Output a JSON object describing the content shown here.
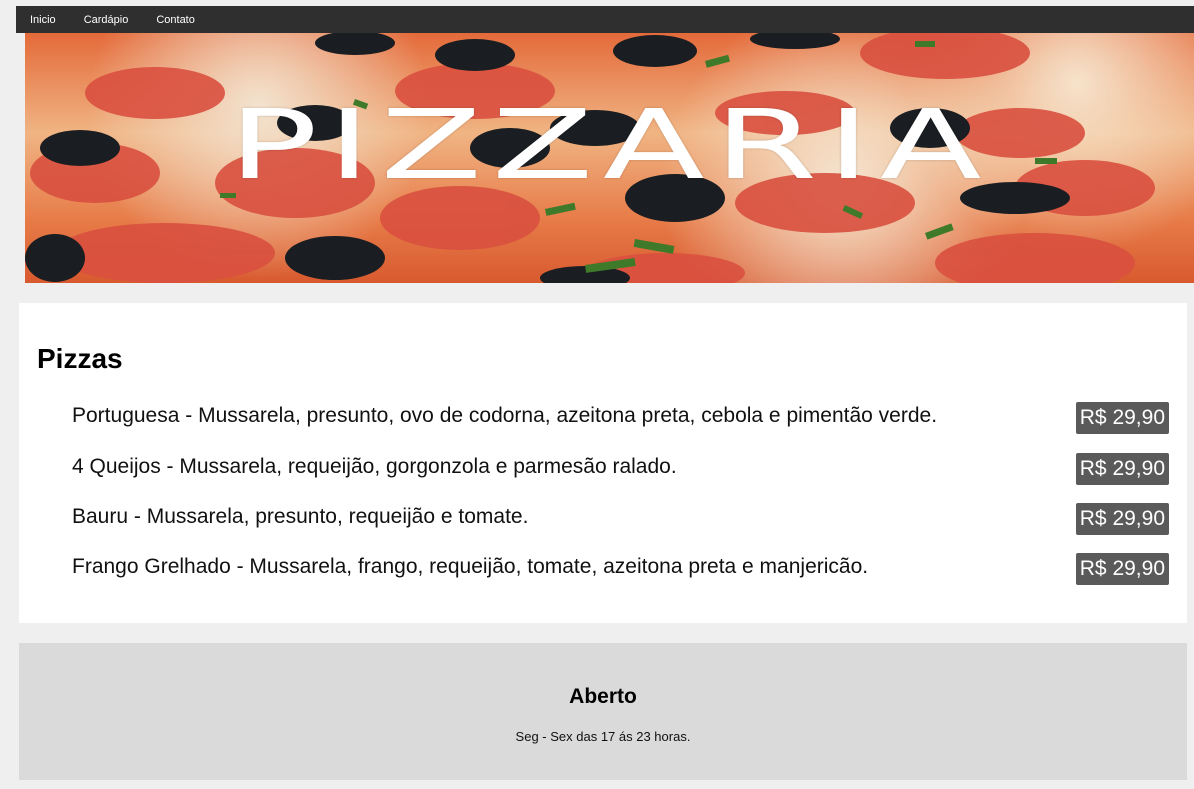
{
  "nav": {
    "items": [
      "Inicio",
      "Cardápio",
      "Contato"
    ]
  },
  "hero": {
    "title": "PIZZARIA",
    "image": "pepperoni-pizza-photo"
  },
  "menu": {
    "heading": "Pizzas",
    "items": [
      {
        "desc": "Portuguesa - Mussarela, presunto, ovo de codorna, azeitona preta, cebola e pimentão verde.",
        "price": "R$ 29,90"
      },
      {
        "desc": "4 Queijos - Mussarela, requeijão, gorgonzola e parmesão ralado.",
        "price": "R$ 29,90"
      },
      {
        "desc": "Bauru - Mussarela, presunto, requeijão e tomate.",
        "price": "R$ 29,90"
      },
      {
        "desc": "Frango Grelhado - Mussarela, frango, requeijão, tomate, azeitona preta e manjericão.",
        "price": "R$ 29,90"
      }
    ]
  },
  "footer": {
    "heading": "Aberto",
    "hours": "Seg - Sex das 17 ás 23 horas."
  },
  "colors": {
    "nav_bg": "#2f2f2f",
    "price_bg": "#5a5a5a",
    "footer_bg": "#dadada",
    "page_bg": "#efefef"
  }
}
